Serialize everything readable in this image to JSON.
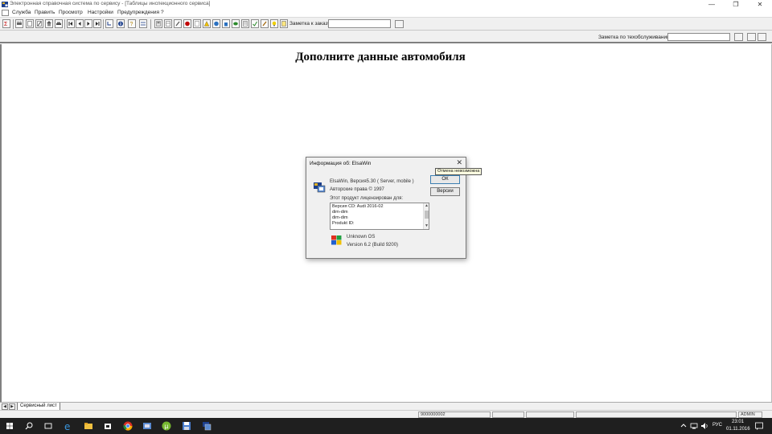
{
  "window": {
    "title": "Электронная справочная система по сервису - [Таблицы инспекционного сервиса]",
    "minimize": "—",
    "maximize": "❐",
    "close": "✕"
  },
  "menu": {
    "items": [
      "Служба",
      "Править",
      "Просмотр",
      "Настройки",
      "Предупреждения",
      "?"
    ]
  },
  "toolbar": {
    "order_note_label": "Заметка к заказу:",
    "order_note_value": ""
  },
  "techbar": {
    "tech_note_label": "Заметка по техобслуживанию:",
    "tech_note_value": ""
  },
  "main": {
    "heading": "Дополните данные автомобиля"
  },
  "dialog": {
    "title": "Информация об: ElsaWin",
    "close": "✕",
    "product_line": "ElsaWin, Версия5.30 ( Server, mobile )",
    "copyright": "Авторские права © 1997",
    "licensed_label": "Этот продукт лицензирован для:",
    "license_lines": [
      "Версия CD: Audi 2016-02",
      "dim-dim",
      "dim-dim",
      "Produkt ID:"
    ],
    "os_name": "Unknown OS",
    "os_version": "Version 6.2 (Build 9200)",
    "ok_label": "ОК",
    "version_label": "Версии"
  },
  "tooltip": {
    "text": "Отмена невозможна"
  },
  "tabs": {
    "active": "Сервисный лист"
  },
  "status": {
    "number": "9000000002",
    "user": "ADMIN"
  },
  "taskbar": {
    "lang": "РУС",
    "time": "23:01",
    "date": "01.11.2016"
  },
  "colors": {
    "taskbar": "#1f1f1f",
    "accent": "#3c7fb1",
    "toolbar": "#f0f0f0"
  }
}
